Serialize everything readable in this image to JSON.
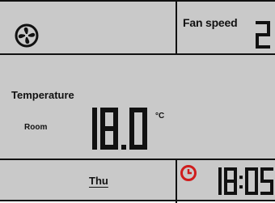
{
  "fan": {
    "icon": "fan-icon",
    "speed_label": "Fan speed",
    "speed_value": "2"
  },
  "temperature": {
    "label": "Temperature",
    "sub_label": "Room",
    "value": "18.0",
    "unit": "°C"
  },
  "status": {
    "day": "Thu",
    "clock_icon": "clock-icon",
    "time": "18:05"
  },
  "colors": {
    "lcd_background": "#c9c9c9",
    "segment": "#111111",
    "clock_accent": "#d01c1c"
  }
}
